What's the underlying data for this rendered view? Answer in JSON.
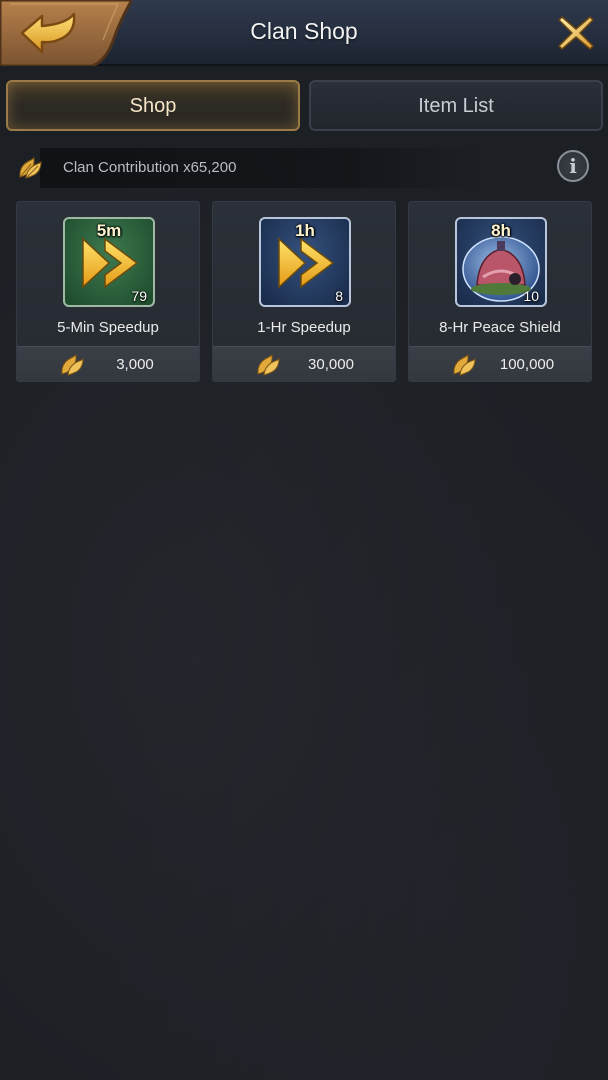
{
  "header": {
    "title": "Clan Shop",
    "back_icon": "arrow-back-icon",
    "close_icon": "close-icon"
  },
  "tabs": [
    {
      "label": "Shop",
      "active": true
    },
    {
      "label": "Item List",
      "active": false
    }
  ],
  "contribution": {
    "icon": "leaf-icon",
    "text": "Clan Contribution x65,200",
    "info_icon": "info-icon"
  },
  "items": [
    {
      "badge": "5m",
      "count": "79",
      "name": "5-Min Speedup",
      "price": "3,000",
      "icon": "speedup-icon"
    },
    {
      "badge": "1h",
      "count": "8",
      "name": "1-Hr Speedup",
      "price": "30,000",
      "icon": "speedup-icon"
    },
    {
      "badge": "8h",
      "count": "10",
      "name": "8-Hr Peace Shield",
      "price": "100,000",
      "icon": "peace-shield-icon"
    }
  ],
  "colors": {
    "gold": "#e9b64a",
    "active_tab_border": "#9a7a45",
    "background": "#1c1f24"
  }
}
